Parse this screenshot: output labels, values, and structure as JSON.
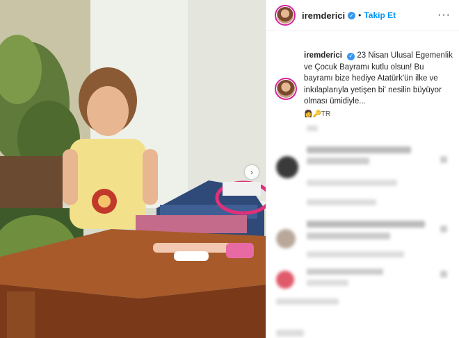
{
  "header": {
    "username": "iremderici",
    "separator": "•",
    "follow_label": "Takip Et",
    "more_label": "···"
  },
  "caption": {
    "username": "iremderici",
    "text": "23 Nisan Ulusal Egemenlik ve Çocuk Bayramı kutlu olsun! Bu bayramı bize hediye Atatürk'ün ilke ve inkılaplarıyla yetişen bi' nesilin büyüyor olması ümidiyle...",
    "flag_text": "TR"
  },
  "carousel": {
    "next_icon": "›"
  },
  "colors": {
    "accent": "#0095f6",
    "verified": "#3897f0",
    "story_ring": "#d6249f"
  }
}
